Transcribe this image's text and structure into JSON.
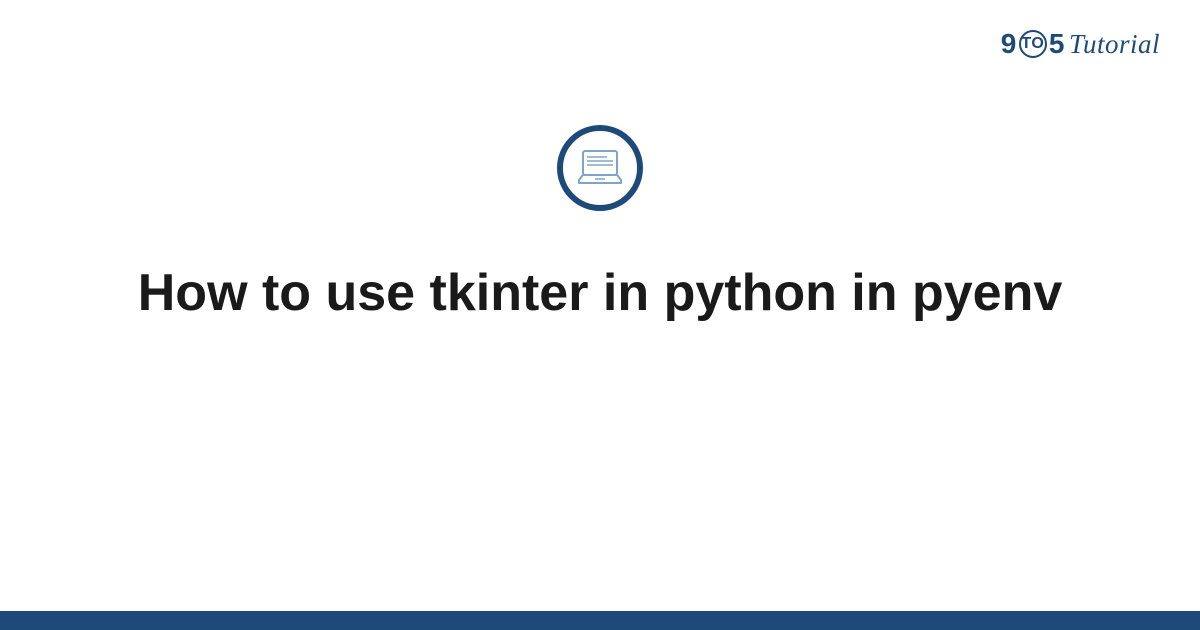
{
  "logo": {
    "nine": "9",
    "to": "TO",
    "five": "5",
    "tutorial": "Tutorial"
  },
  "main": {
    "title": "How to use tkinter in python in pyenv"
  },
  "colors": {
    "brand": "#1e4a7a",
    "laptop_stroke": "#7da5cc"
  }
}
